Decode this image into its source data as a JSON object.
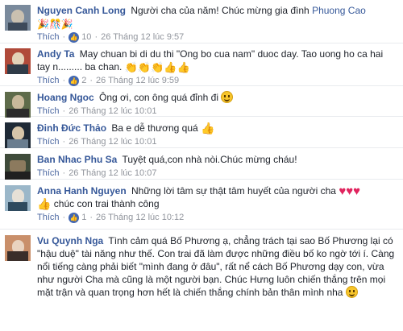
{
  "comments": [
    {
      "name": "Nguyen Canh Long",
      "text": "Người cha của năm! Chúc mừng gia đình",
      "mention": "Phuong Cao",
      "emojis": "🎉🎊🎉",
      "like_label": "Thích",
      "likes": "10",
      "time": "26 Tháng 12 lúc 9:57",
      "avatar_colors": [
        "#7a8a9c",
        "#c9c0b0",
        "#3d4a5a"
      ]
    },
    {
      "name": "Andy Ta",
      "text": "May chuan bi di du thi \"Ong bo cua nam\" duoc day. Tao uong ho ca hai tay n......... ba chan.",
      "emojis": "👏👏👏👍👍",
      "like_label": "Thích",
      "likes": "2",
      "time": "26 Tháng 12 lúc 9:59",
      "avatar_colors": [
        "#b04a3a",
        "#2f3b48",
        "#e3d2b8"
      ]
    },
    {
      "name": "Hoang Ngoc",
      "text": "Ông ơi, con ông quá đỉnh đi",
      "like_label": "Thích",
      "time": "26 Tháng 12 lúc 10:01",
      "avatar_colors": [
        "#5e6b4a",
        "#c8b89a",
        "#2b2b2b"
      ]
    },
    {
      "name": "Đinh Đức Thảo",
      "text": "Ba e dễ thương quá",
      "like_label": "Thích",
      "time": "26 Tháng 12 lúc 10:01",
      "avatar_colors": [
        "#1f2a36",
        "#6a7d8f",
        "#d7c5a9"
      ]
    },
    {
      "name": "Ban Nhac Phu Sa",
      "text": "Tuyệt quá,con nhà nòi.Chúc mừng cháu!",
      "like_label": "Thích",
      "time": "26 Tháng 12 lúc 10:07",
      "avatar_colors": [
        "#3f4b3a",
        "#8c7a5e",
        "#202020"
      ]
    },
    {
      "name": "Anna Hanh Nguyen",
      "text": "Những lời tâm sự thật tâm huyết của người cha",
      "text2": "chúc con trai thành công",
      "like_label": "Thích",
      "likes": "1",
      "time": "26 Tháng 12 lúc 10:12",
      "avatar_colors": [
        "#9bb7c9",
        "#2e4a5e",
        "#e6e0d6"
      ]
    },
    {
      "name": "Vu Quynh Nga",
      "text": "Tình cảm quá Bố Phương ạ, chẳng trách tại sao Bố Phương lại có \"hậu duệ\" tài năng như thế. Con trai đã làm được những điều bố ko ngờ tới í. Càng nổi tiếng càng phải biết \"mình đang ở đâu\", rất nể cách Bố Phương dạy con, vừa như người Cha mà cũng là một người bạn. Chúc Hưng luôn chiến thắng trên mọi mặt trận và quan trọng hơn hết là chiến thắng chính bản thân mình nha",
      "avatar_colors": [
        "#c98f6a",
        "#3a2e2a",
        "#e9d3c0"
      ]
    }
  ],
  "colors": {
    "name": "#365899",
    "meta": "#90949c",
    "like_badge": "#4267b2"
  }
}
